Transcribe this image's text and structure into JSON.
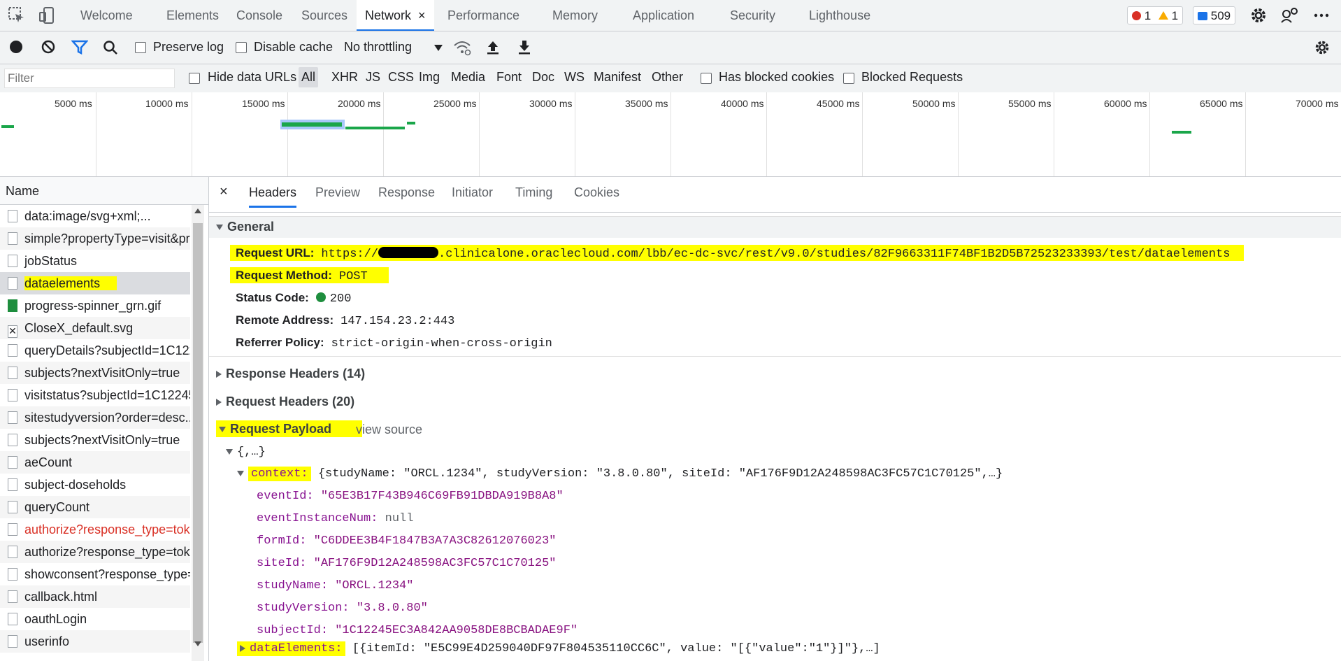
{
  "tabs": {
    "welcome": "Welcome",
    "elements": "Elements",
    "console": "Console",
    "sources": "Sources",
    "network": "Network",
    "performance": "Performance",
    "memory": "Memory",
    "application": "Application",
    "security": "Security",
    "lighthouse": "Lighthouse",
    "close_symbol": "×"
  },
  "badges": {
    "errors": "1",
    "warnings": "1",
    "messages": "509"
  },
  "toolbar": {
    "preserve_log": "Preserve log",
    "disable_cache": "Disable cache",
    "throttling": "No throttling"
  },
  "filter": {
    "placeholder": "Filter",
    "hide_data_urls": "Hide data URLs",
    "types": [
      "All",
      "XHR",
      "JS",
      "CSS",
      "Img",
      "Media",
      "Font",
      "Doc",
      "WS",
      "Manifest",
      "Other"
    ],
    "has_blocked_cookies": "Has blocked cookies",
    "blocked_requests": "Blocked Requests"
  },
  "timeline": {
    "ticks": [
      "5000 ms",
      "10000 ms",
      "15000 ms",
      "20000 ms",
      "25000 ms",
      "30000 ms",
      "35000 ms",
      "40000 ms",
      "45000 ms",
      "50000 ms",
      "55000 ms",
      "60000 ms",
      "65000 ms",
      "70000 ms"
    ]
  },
  "names": {
    "header": "Name",
    "rows": [
      "data:image/svg+xml;...",
      "simple?propertyType=visit&pr",
      "jobStatus",
      "dataelements",
      "progress-spinner_grn.gif",
      "CloseX_default.svg",
      "queryDetails?subjectId=1C122",
      "subjects?nextVisitOnly=true",
      "visitstatus?subjectId=1C12245",
      "sitestudyversion?order=desc...",
      "subjects?nextVisitOnly=true",
      "aeCount",
      "subject-doseholds",
      "queryCount",
      "authorize?response_type=tok",
      "authorize?response_type=tok",
      "showconsent?response_type=",
      "callback.html",
      "oauthLogin",
      "userinfo"
    ]
  },
  "detail_tabs": {
    "close": "×",
    "headers": "Headers",
    "preview": "Preview",
    "response": "Response",
    "initiator": "Initiator",
    "timing": "Timing",
    "cookies": "Cookies"
  },
  "general": {
    "title": "General",
    "request_url_label": "Request URL:",
    "request_url_prefix": "https://",
    "request_url_rest": ".clinicalone.oraclecloud.com/lbb/ec-dc-svc/rest/v9.0/studies/82F9663311F74BF1B2D5B72523233393/test/dataelements",
    "request_method_label": "Request Method:",
    "request_method": "POST",
    "status_code_label": "Status Code:",
    "status_code": "200",
    "remote_address_label": "Remote Address:",
    "remote_address": "147.154.23.2:443",
    "referrer_policy_label": "Referrer Policy:",
    "referrer_policy": "strict-origin-when-cross-origin"
  },
  "sections": {
    "response_headers": "Response Headers (14)",
    "request_headers": "Request Headers (20)",
    "request_payload": "Request Payload",
    "view_source": "view source"
  },
  "payload": {
    "root": "{,…}",
    "context_key": "context:",
    "context_summary": "{studyName: \"ORCL.1234\", studyVersion: \"3.8.0.80\", siteId: \"AF176F9D12A248598AC3FC57C1C70125\",…}",
    "fields": [
      {
        "key": "eventId:",
        "value": "\"65E3B17F43B946C69FB91DBDA919B8A8\""
      },
      {
        "key": "eventInstanceNum:",
        "value": "null"
      },
      {
        "key": "formId:",
        "value": "\"C6DDEE3B4F1847B3A7A3C82612076023\""
      },
      {
        "key": "siteId:",
        "value": "\"AF176F9D12A248598AC3FC57C1C70125\""
      },
      {
        "key": "studyName:",
        "value": "\"ORCL.1234\""
      },
      {
        "key": "studyVersion:",
        "value": "\"3.8.0.80\""
      },
      {
        "key": "subjectId:",
        "value": "\"1C12245EC3A842AA9058DE8BCBADAE9F\""
      }
    ],
    "data_elements_key": "dataElements:",
    "data_elements_summary": "[{itemId: \"E5C99E4D259040DF97F804535110CC6C\", value: \"[{\"value\":\"1\"}]\"},…]"
  },
  "colors": {
    "highlight": "#ffff00",
    "accent": "#1a73e8",
    "timeline_bar": "#1aa64a",
    "payload_value": "#881280",
    "error_row": "#d93025"
  }
}
